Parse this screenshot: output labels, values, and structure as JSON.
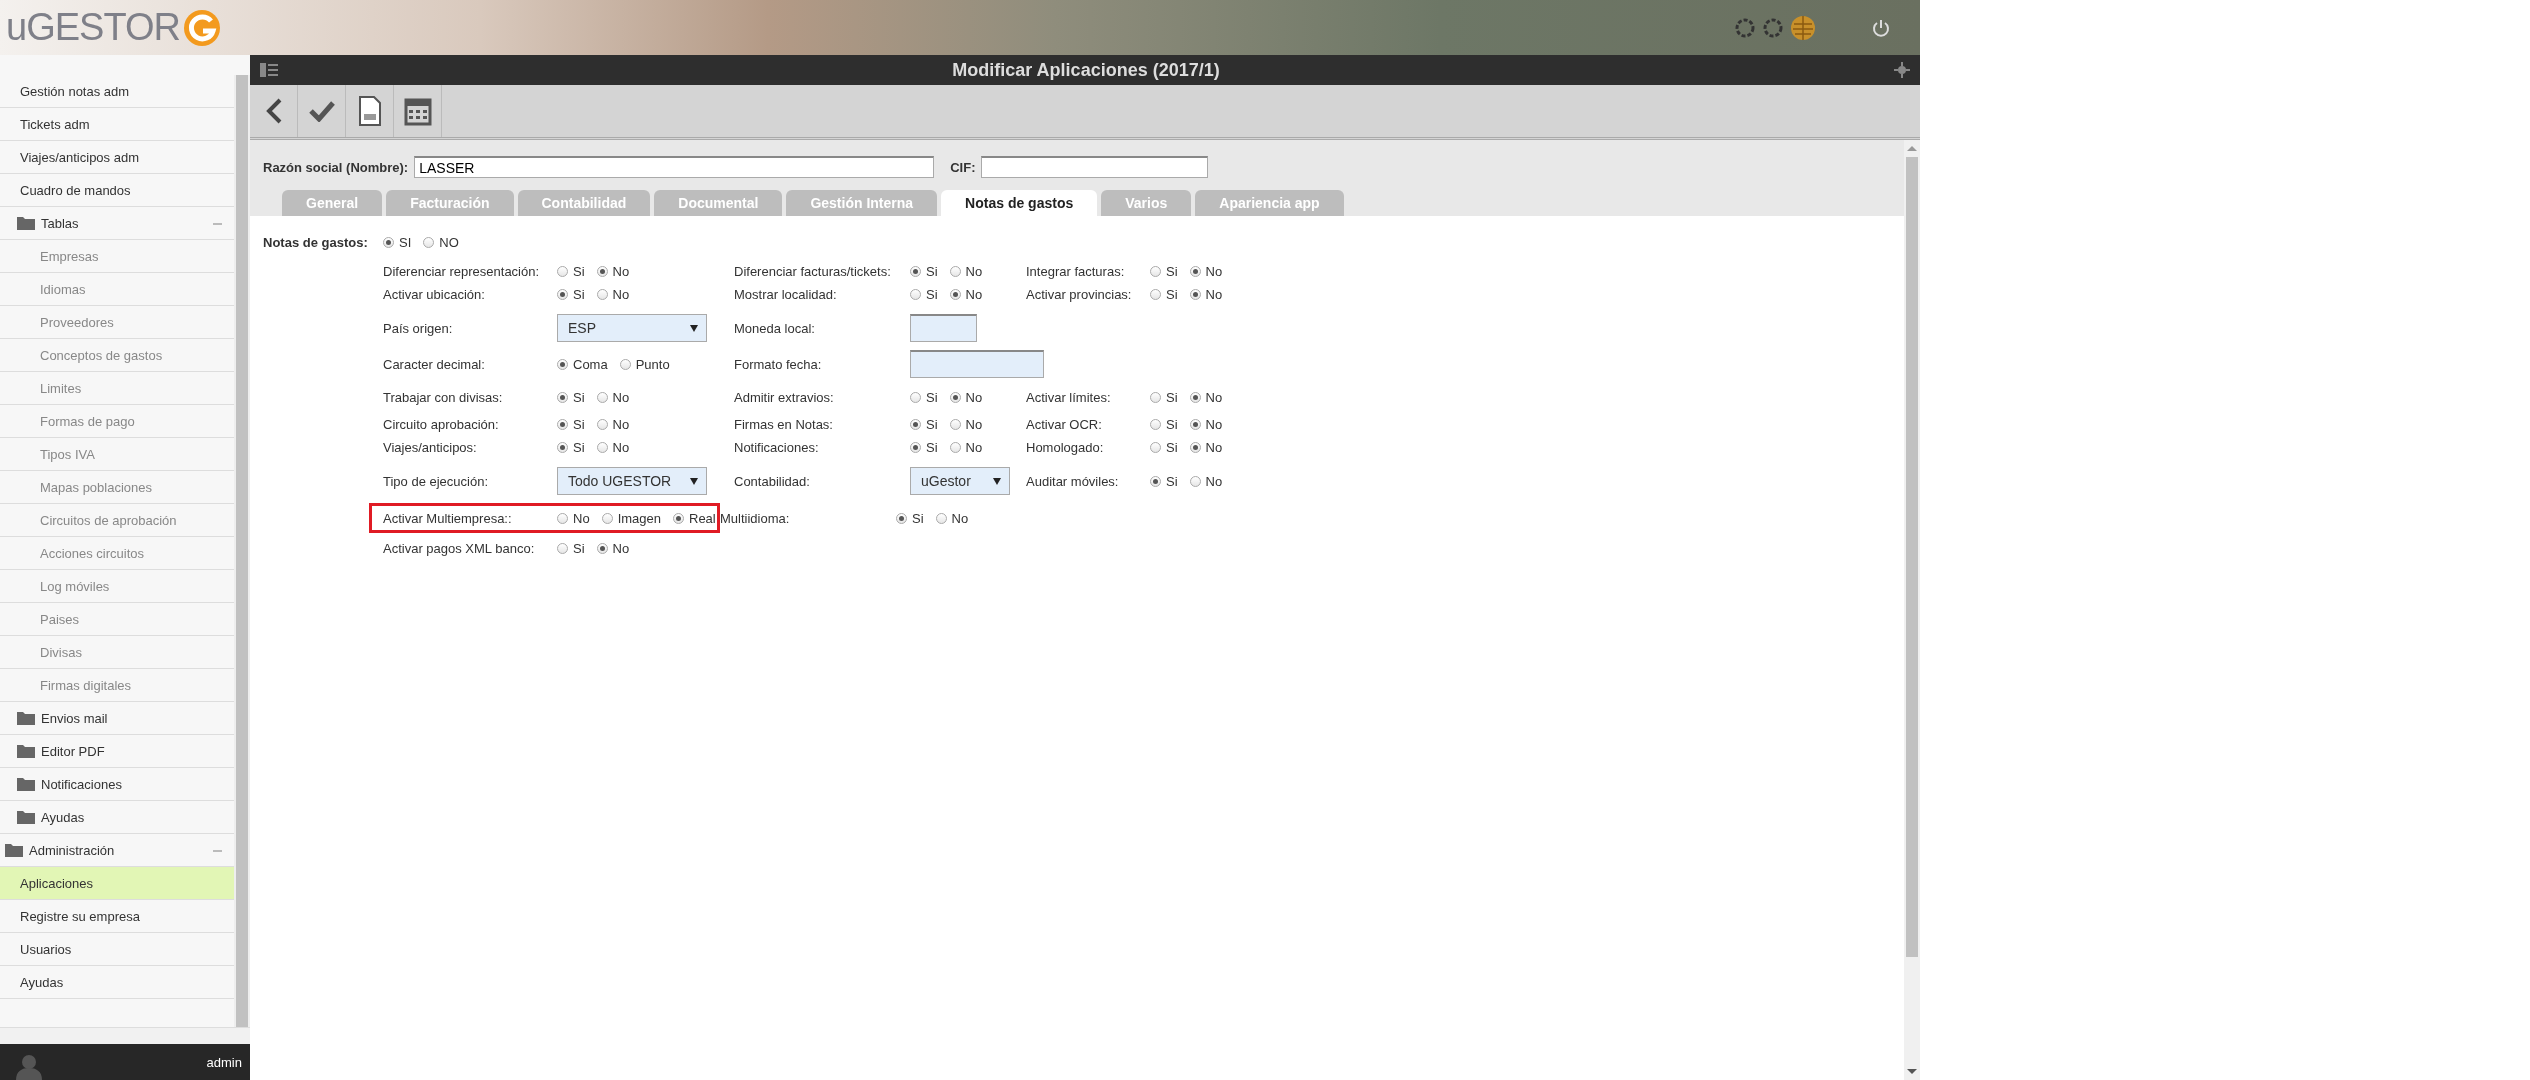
{
  "header": {
    "logo": "uGESTOR"
  },
  "sidebar": {
    "items": [
      {
        "kind": "link",
        "label": "Gestión notas adm",
        "selected": false
      },
      {
        "kind": "link",
        "label": "Tickets adm",
        "selected": false
      },
      {
        "kind": "link",
        "label": "Viajes/anticipos adm",
        "selected": false
      },
      {
        "kind": "link",
        "label": "Cuadro de mandos",
        "selected": false
      },
      {
        "kind": "folder",
        "label": "Tablas",
        "expanded": true,
        "children": [
          {
            "label": "Empresas",
            "selected": false
          },
          {
            "label": "Idiomas",
            "selected": false
          },
          {
            "label": "Proveedores",
            "selected": false
          },
          {
            "label": "Conceptos de gastos",
            "selected": false
          },
          {
            "label": "Limites",
            "selected": false
          },
          {
            "label": "Formas de pago",
            "selected": false
          },
          {
            "label": "Tipos IVA",
            "selected": false
          },
          {
            "label": "Mapas poblaciones",
            "selected": false
          },
          {
            "label": "Circuitos de aprobación",
            "selected": false
          },
          {
            "label": "Acciones circuitos",
            "selected": false
          },
          {
            "label": "Log móviles",
            "selected": false
          },
          {
            "label": "Paises",
            "selected": false
          },
          {
            "label": "Divisas",
            "selected": false
          },
          {
            "label": "Firmas digitales",
            "selected": false
          }
        ]
      },
      {
        "kind": "folder",
        "label": "Envios mail",
        "expanded": false
      },
      {
        "kind": "folder",
        "label": "Editor PDF",
        "expanded": false
      },
      {
        "kind": "folder",
        "label": "Notificaciones",
        "expanded": false
      },
      {
        "kind": "folder",
        "label": "Ayudas",
        "expanded": false
      }
    ],
    "sections": [
      {
        "label": "Administración",
        "expanded": true,
        "children": [
          {
            "label": "Aplicaciones",
            "selected": true
          },
          {
            "label": "Registre su empresa",
            "selected": false
          },
          {
            "label": "Usuarios",
            "selected": false
          },
          {
            "label": "Ayudas",
            "selected": false
          }
        ]
      }
    ],
    "user": "admin"
  },
  "title_bar": {
    "title": "Modificar Aplicaciones (2017/1)"
  },
  "company": {
    "name_label": "Razón social (Nombre):",
    "name_value": "LASSER",
    "cif_label": "CIF:"
  },
  "tabs": [
    {
      "label": "General",
      "selected": false
    },
    {
      "label": "Facturación",
      "selected": false
    },
    {
      "label": "Contabilidad",
      "selected": false
    },
    {
      "label": "Documental",
      "selected": false
    },
    {
      "label": "Gestión Interna",
      "selected": false
    },
    {
      "label": "Notas de gastos",
      "selected": true
    },
    {
      "label": "Varios",
      "selected": false
    },
    {
      "label": "Apariencia app",
      "selected": false
    }
  ],
  "master": {
    "label": "Notas de gastos:",
    "options": [
      {
        "label": "SI",
        "selected": true
      },
      {
        "label": "NO",
        "selected": false
      }
    ]
  },
  "rows": [
    {
      "fields": [
        {
          "kind": "radio",
          "label": "Diferenciar representación:",
          "options": [
            {
              "label": "Si",
              "selected": false
            },
            {
              "label": "No",
              "selected": true
            }
          ]
        },
        {
          "kind": "radio",
          "label": "Diferenciar facturas/tickets:",
          "options": [
            {
              "label": "Si",
              "selected": true
            },
            {
              "label": "No",
              "selected": false
            }
          ]
        },
        {
          "kind": "radio",
          "label": "Integrar facturas:",
          "options": [
            {
              "label": "Si",
              "selected": false
            },
            {
              "label": "No",
              "selected": true
            }
          ]
        }
      ]
    },
    {
      "fields": [
        {
          "kind": "radio",
          "label": "Activar ubicación:",
          "options": [
            {
              "label": "Si",
              "selected": true
            },
            {
              "label": "No",
              "selected": false
            }
          ]
        },
        {
          "kind": "radio",
          "label": "Mostrar localidad:",
          "options": [
            {
              "label": "Si",
              "selected": false
            },
            {
              "label": "No",
              "selected": true
            }
          ]
        },
        {
          "kind": "radio",
          "label": "Activar provincias:",
          "options": [
            {
              "label": "Si",
              "selected": false
            },
            {
              "label": "No",
              "selected": true
            }
          ]
        }
      ]
    },
    {
      "fields": [
        {
          "kind": "select",
          "label": "País origen:",
          "value": "ESP"
        },
        {
          "kind": "input",
          "label": "Moneda local:"
        }
      ]
    },
    {
      "fields": [
        {
          "kind": "radio",
          "label": "Caracter decimal:",
          "options": [
            {
              "label": "Coma",
              "selected": true
            },
            {
              "label": "Punto",
              "selected": false
            }
          ]
        },
        {
          "kind": "input",
          "label": "Formato fecha:"
        }
      ]
    },
    {
      "fields": [
        {
          "kind": "radio",
          "label": "Trabajar con divisas:",
          "options": [
            {
              "label": "Si",
              "selected": true
            },
            {
              "label": "No",
              "selected": false
            }
          ]
        },
        {
          "kind": "radio",
          "label": "Admitir extravios:",
          "options": [
            {
              "label": "Si",
              "selected": false
            },
            {
              "label": "No",
              "selected": true
            }
          ]
        },
        {
          "kind": "radio",
          "label": "Activar límites:",
          "options": [
            {
              "label": "Si",
              "selected": false
            },
            {
              "label": "No",
              "selected": true
            }
          ]
        }
      ]
    },
    {
      "fields": [
        {
          "kind": "radio",
          "label": "Circuito aprobación:",
          "options": [
            {
              "label": "Si",
              "selected": true
            },
            {
              "label": "No",
              "selected": false
            }
          ]
        },
        {
          "kind": "radio",
          "label": "Firmas en Notas:",
          "options": [
            {
              "label": "Si",
              "selected": true
            },
            {
              "label": "No",
              "selected": false
            }
          ]
        },
        {
          "kind": "radio",
          "label": "Activar OCR:",
          "options": [
            {
              "label": "Si",
              "selected": false
            },
            {
              "label": "No",
              "selected": true
            }
          ]
        }
      ]
    },
    {
      "fields": [
        {
          "kind": "radio",
          "label": "Viajes/anticipos:",
          "options": [
            {
              "label": "Si",
              "selected": true
            },
            {
              "label": "No",
              "selected": false
            }
          ]
        },
        {
          "kind": "radio",
          "label": "Notificaciones:",
          "options": [
            {
              "label": "Si",
              "selected": true
            },
            {
              "label": "No",
              "selected": false
            }
          ]
        },
        {
          "kind": "radio",
          "label": "Homologado:",
          "options": [
            {
              "label": "Si",
              "selected": false
            },
            {
              "label": "No",
              "selected": true
            }
          ]
        }
      ]
    },
    {
      "fields": [
        {
          "kind": "select",
          "label": "Tipo de ejecución:",
          "value": "Todo UGESTOR"
        },
        {
          "kind": "select",
          "label": "Contabilidad:",
          "value": "uGestor"
        },
        {
          "kind": "radio",
          "label": "Auditar móviles:",
          "options": [
            {
              "label": "Si",
              "selected": true
            },
            {
              "label": "No",
              "selected": false
            }
          ]
        }
      ]
    },
    {
      "fields": [
        {
          "kind": "radio",
          "label": "Activar Multiempresa::",
          "highlighted": true,
          "options": [
            {
              "label": "No",
              "selected": false
            },
            {
              "label": "Imagen",
              "selected": false
            },
            {
              "label": "Real",
              "selected": true
            }
          ]
        },
        {
          "kind": "radio",
          "label": "Multiidioma:",
          "options": [
            {
              "label": "Si",
              "selected": true
            },
            {
              "label": "No",
              "selected": false
            }
          ]
        }
      ]
    },
    {
      "fields": [
        {
          "kind": "radio",
          "label": "Activar pagos XML banco:",
          "options": [
            {
              "label": "Si",
              "selected": false
            },
            {
              "label": "No",
              "selected": true
            }
          ]
        }
      ]
    }
  ]
}
